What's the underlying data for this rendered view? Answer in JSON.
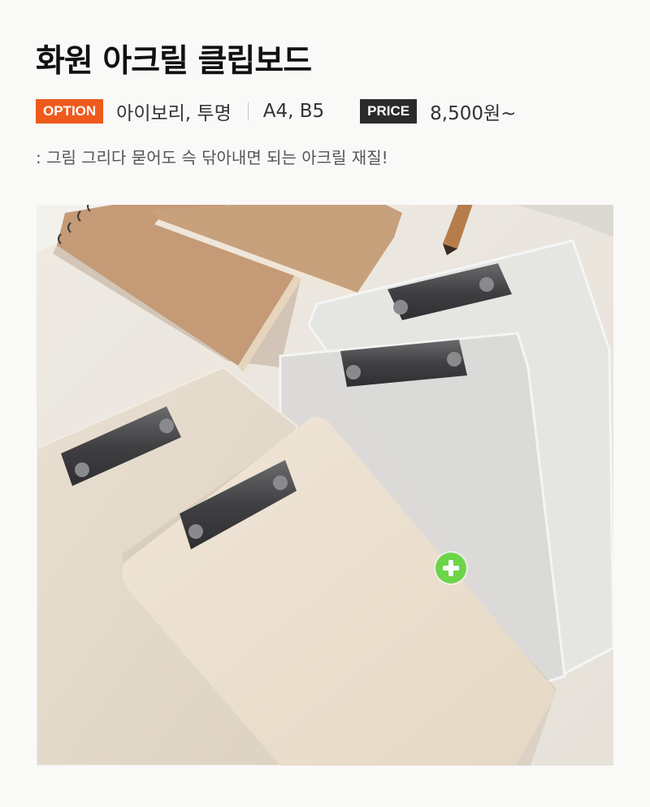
{
  "product": {
    "title": "화원 아크릴 클립보드",
    "option_label": "OPTION",
    "option_colors": "아이보리, 투명",
    "option_sizes": "A4, B5",
    "price_label": "PRICE",
    "price_value": "8,500원~",
    "description": ": 그림 그리다 묻어도 슥 닦아내면 되는 아크릴 재질!"
  },
  "photo": {
    "icon": "plus-icon",
    "colors": {
      "background": "#efece6",
      "kraft": "#c49b76",
      "ivory_board": "#ece1d2",
      "clear_board": "#dcdcdb",
      "clip": "#4a4a4c",
      "accent_plus": "#6cd54a"
    }
  },
  "colors": {
    "option_badge": "#ef5a1c",
    "price_badge": "#2b2b2b"
  }
}
